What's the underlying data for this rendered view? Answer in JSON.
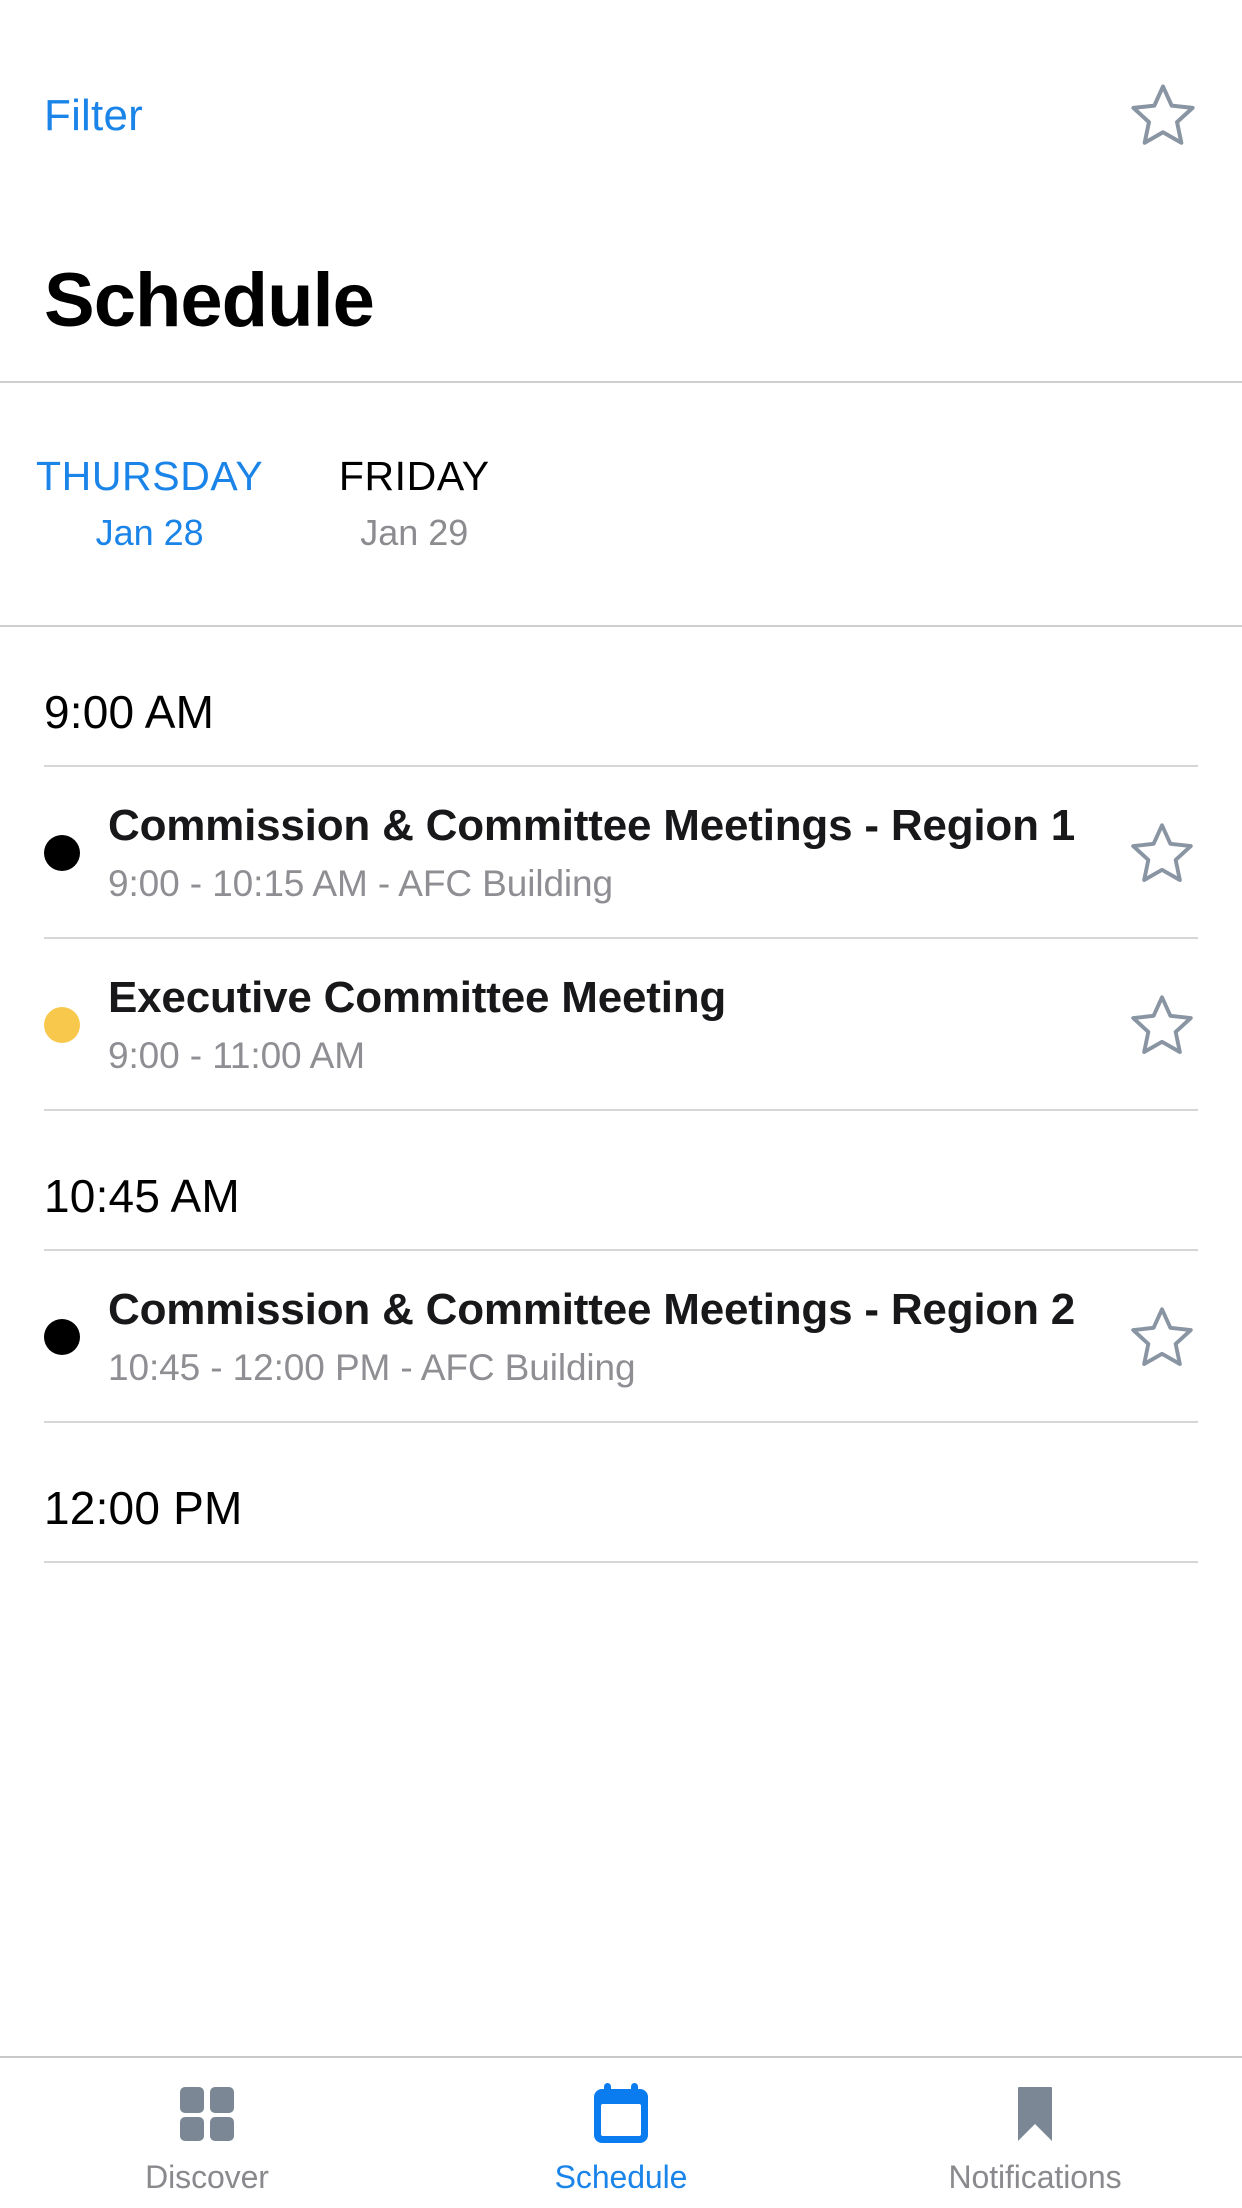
{
  "topbar": {
    "filter_label": "Filter",
    "favorites_icon": "star-outline-icon"
  },
  "header": {
    "title": "Schedule"
  },
  "day_tabs": [
    {
      "name": "THURSDAY",
      "date": "Jan 28",
      "active": true
    },
    {
      "name": "FRIDAY",
      "date": "Jan 29",
      "active": false
    }
  ],
  "schedule": [
    {
      "time_header": "9:00 AM",
      "events": [
        {
          "title": "Commission & Committee Meetings - Region 1",
          "subtitle": "9:00 - 10:15 AM - AFC Building",
          "dot_color": "#000000",
          "star_icon": "star-outline-icon"
        },
        {
          "title": "Executive Committee Meeting",
          "subtitle": "9:00 - 11:00 AM",
          "dot_color": "#f7c84c",
          "star_icon": "star-outline-icon"
        }
      ]
    },
    {
      "time_header": "10:45 AM",
      "events": [
        {
          "title": "Commission & Committee Meetings - Region 2",
          "subtitle": "10:45 - 12:00 PM - AFC Building",
          "dot_color": "#000000",
          "star_icon": "star-outline-icon"
        }
      ]
    },
    {
      "time_header": "12:00 PM",
      "events": []
    }
  ],
  "tabbar": {
    "items": [
      {
        "label": "Discover",
        "icon": "grid-icon",
        "active": false
      },
      {
        "label": "Schedule",
        "icon": "calendar-icon",
        "active": true
      },
      {
        "label": "Notifications",
        "icon": "bookmark-icon",
        "active": false
      }
    ]
  },
  "colors": {
    "accent": "#1a84e8",
    "inactive_gray": "#8a8a8e",
    "icon_slate": "#7c8795",
    "divider": "#d6d6d8",
    "highlight_dot": "#f7c84c"
  }
}
